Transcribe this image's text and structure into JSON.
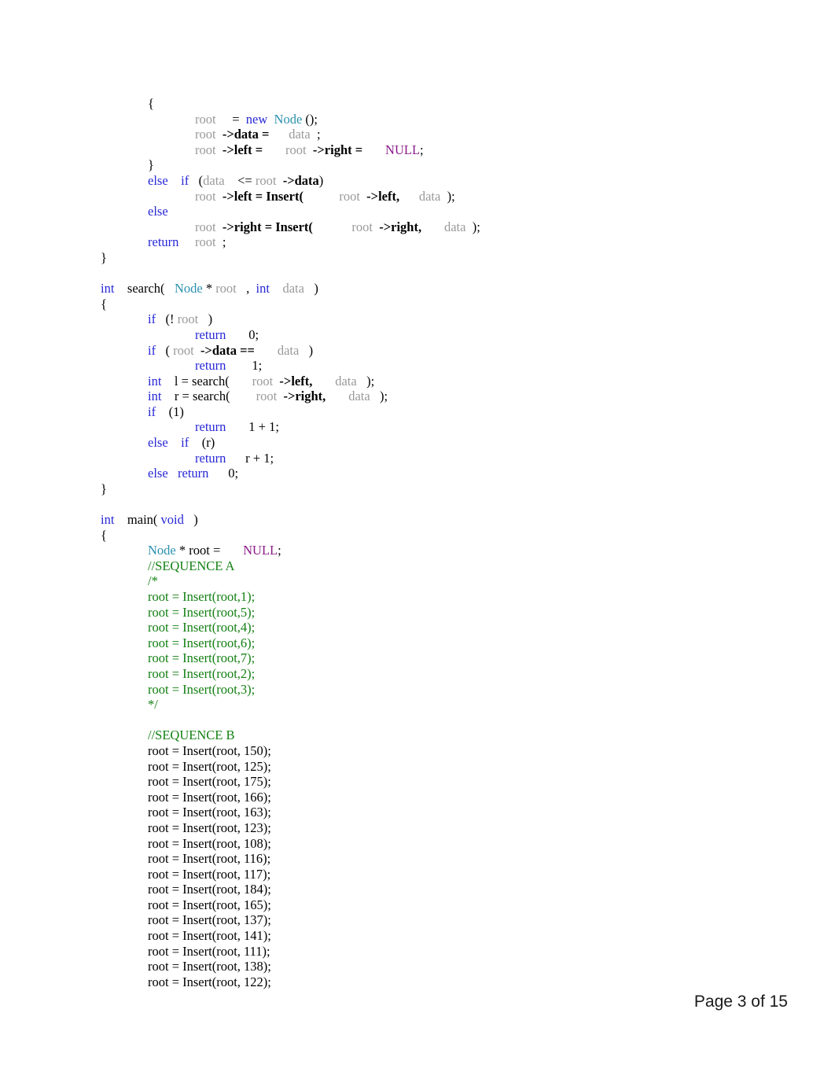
{
  "document": {
    "page_label": "Page 3 of 15",
    "colors": {
      "keyword": "#2727d6",
      "type": "#2b91af",
      "identifier": "#9a9a9a",
      "member": "#000000",
      "macro": "#8b1a8b",
      "comment": "#138013",
      "plain": "#000000",
      "background": "#ffffff"
    }
  },
  "code": {
    "lines": [
      {
        "indent": 1,
        "tokens": [
          {
            "t": "{",
            "c": "pl"
          }
        ]
      },
      {
        "indent": 2,
        "tokens": [
          {
            "t": "root",
            "c": "id"
          },
          {
            "t": "     =  ",
            "c": "pl"
          },
          {
            "t": "new",
            "c": "kw"
          },
          {
            "t": "  ",
            "c": "pl"
          },
          {
            "t": "Node",
            "c": "type"
          },
          {
            "t": " ();",
            "c": "pl"
          }
        ]
      },
      {
        "indent": 2,
        "tokens": [
          {
            "t": "root",
            "c": "id"
          },
          {
            "t": "  ",
            "c": "pl"
          },
          {
            "t": "->data =",
            "c": "mem"
          },
          {
            "t": "      ",
            "c": "pl"
          },
          {
            "t": "data",
            "c": "id"
          },
          {
            "t": "  ;",
            "c": "pl"
          }
        ]
      },
      {
        "indent": 2,
        "tokens": [
          {
            "t": "root",
            "c": "id"
          },
          {
            "t": "  ",
            "c": "pl"
          },
          {
            "t": "->left =",
            "c": "mem"
          },
          {
            "t": "       ",
            "c": "pl"
          },
          {
            "t": "root",
            "c": "id"
          },
          {
            "t": "  ",
            "c": "pl"
          },
          {
            "t": "->right =",
            "c": "mem"
          },
          {
            "t": "       ",
            "c": "pl"
          },
          {
            "t": "NULL",
            "c": "nul"
          },
          {
            "t": ";",
            "c": "pl"
          }
        ]
      },
      {
        "indent": 1,
        "tokens": [
          {
            "t": "}",
            "c": "pl"
          }
        ]
      },
      {
        "indent": 1,
        "tokens": [
          {
            "t": "else",
            "c": "kw"
          },
          {
            "t": "    ",
            "c": "pl"
          },
          {
            "t": "if",
            "c": "kw"
          },
          {
            "t": "   (",
            "c": "pl"
          },
          {
            "t": "data",
            "c": "id"
          },
          {
            "t": "    <= ",
            "c": "pl"
          },
          {
            "t": "root",
            "c": "id"
          },
          {
            "t": "  ",
            "c": "pl"
          },
          {
            "t": "->data",
            "c": "mem"
          },
          {
            "t": ")",
            "c": "pl"
          }
        ]
      },
      {
        "indent": 2,
        "tokens": [
          {
            "t": "root",
            "c": "id"
          },
          {
            "t": "  ",
            "c": "pl"
          },
          {
            "t": "->left = Insert(",
            "c": "mem"
          },
          {
            "t": "           ",
            "c": "pl"
          },
          {
            "t": "root",
            "c": "id"
          },
          {
            "t": "  ",
            "c": "pl"
          },
          {
            "t": "->left,",
            "c": "mem"
          },
          {
            "t": "      ",
            "c": "pl"
          },
          {
            "t": "data",
            "c": "id"
          },
          {
            "t": "  );",
            "c": "pl"
          }
        ]
      },
      {
        "indent": 1,
        "tokens": [
          {
            "t": "else",
            "c": "kw"
          }
        ]
      },
      {
        "indent": 2,
        "tokens": [
          {
            "t": "root",
            "c": "id"
          },
          {
            "t": "  ",
            "c": "pl"
          },
          {
            "t": "->right = Insert(",
            "c": "mem"
          },
          {
            "t": "            ",
            "c": "pl"
          },
          {
            "t": "root",
            "c": "id"
          },
          {
            "t": "  ",
            "c": "pl"
          },
          {
            "t": "->right,",
            "c": "mem"
          },
          {
            "t": "       ",
            "c": "pl"
          },
          {
            "t": "data",
            "c": "id"
          },
          {
            "t": "  );",
            "c": "pl"
          }
        ]
      },
      {
        "indent": 1,
        "tokens": [
          {
            "t": "return",
            "c": "kw"
          },
          {
            "t": "     ",
            "c": "pl"
          },
          {
            "t": "root",
            "c": "id"
          },
          {
            "t": "  ;",
            "c": "pl"
          }
        ]
      },
      {
        "indent": 0,
        "tokens": [
          {
            "t": "}",
            "c": "pl"
          }
        ]
      },
      {
        "indent": 0,
        "tokens": []
      },
      {
        "indent": 0,
        "tokens": [
          {
            "t": "int",
            "c": "kw"
          },
          {
            "t": "    search(",
            "c": "pl"
          },
          {
            "t": "   ",
            "c": "pl"
          },
          {
            "t": "Node",
            "c": "type"
          },
          {
            "t": " * ",
            "c": "pl"
          },
          {
            "t": "root",
            "c": "id"
          },
          {
            "t": "   ,  ",
            "c": "pl"
          },
          {
            "t": "int",
            "c": "kw"
          },
          {
            "t": "    ",
            "c": "pl"
          },
          {
            "t": "data",
            "c": "id"
          },
          {
            "t": "   )",
            "c": "pl"
          }
        ]
      },
      {
        "indent": 0,
        "tokens": [
          {
            "t": "{",
            "c": "pl"
          }
        ]
      },
      {
        "indent": 1,
        "tokens": [
          {
            "t": "if",
            "c": "kw"
          },
          {
            "t": "   (! ",
            "c": "pl"
          },
          {
            "t": "root",
            "c": "id"
          },
          {
            "t": "   )",
            "c": "pl"
          }
        ]
      },
      {
        "indent": 2,
        "tokens": [
          {
            "t": "return",
            "c": "kw"
          },
          {
            "t": "       0;",
            "c": "pl"
          }
        ]
      },
      {
        "indent": 1,
        "tokens": [
          {
            "t": "if",
            "c": "kw"
          },
          {
            "t": "   ( ",
            "c": "pl"
          },
          {
            "t": "root",
            "c": "id"
          },
          {
            "t": "  ",
            "c": "pl"
          },
          {
            "t": "->data ==",
            "c": "mem"
          },
          {
            "t": "       ",
            "c": "pl"
          },
          {
            "t": "data",
            "c": "id"
          },
          {
            "t": "   )",
            "c": "pl"
          }
        ]
      },
      {
        "indent": 2,
        "tokens": [
          {
            "t": "return",
            "c": "kw"
          },
          {
            "t": "        1;",
            "c": "pl"
          }
        ]
      },
      {
        "indent": 1,
        "tokens": [
          {
            "t": "int",
            "c": "kw"
          },
          {
            "t": "    l = search(",
            "c": "pl"
          },
          {
            "t": "       ",
            "c": "pl"
          },
          {
            "t": "root",
            "c": "id"
          },
          {
            "t": "  ",
            "c": "pl"
          },
          {
            "t": "->left,",
            "c": "mem"
          },
          {
            "t": "       ",
            "c": "pl"
          },
          {
            "t": "data",
            "c": "id"
          },
          {
            "t": "   );",
            "c": "pl"
          }
        ]
      },
      {
        "indent": 1,
        "tokens": [
          {
            "t": "int",
            "c": "kw"
          },
          {
            "t": "    r = search(",
            "c": "pl"
          },
          {
            "t": "        ",
            "c": "pl"
          },
          {
            "t": "root",
            "c": "id"
          },
          {
            "t": "  ",
            "c": "pl"
          },
          {
            "t": "->right,",
            "c": "mem"
          },
          {
            "t": "       ",
            "c": "pl"
          },
          {
            "t": "data",
            "c": "id"
          },
          {
            "t": "   );",
            "c": "pl"
          }
        ]
      },
      {
        "indent": 1,
        "tokens": [
          {
            "t": "if",
            "c": "kw"
          },
          {
            "t": "    (1)",
            "c": "pl"
          }
        ]
      },
      {
        "indent": 2,
        "tokens": [
          {
            "t": "return",
            "c": "kw"
          },
          {
            "t": "       1 + 1;",
            "c": "pl"
          }
        ]
      },
      {
        "indent": 1,
        "tokens": [
          {
            "t": "else",
            "c": "kw"
          },
          {
            "t": "    ",
            "c": "pl"
          },
          {
            "t": "if",
            "c": "kw"
          },
          {
            "t": "    (r)",
            "c": "pl"
          }
        ]
      },
      {
        "indent": 2,
        "tokens": [
          {
            "t": "return",
            "c": "kw"
          },
          {
            "t": "      r + 1;",
            "c": "pl"
          }
        ]
      },
      {
        "indent": 1,
        "tokens": [
          {
            "t": "else",
            "c": "kw"
          },
          {
            "t": "   ",
            "c": "pl"
          },
          {
            "t": "return",
            "c": "kw"
          },
          {
            "t": "      0;",
            "c": "pl"
          }
        ]
      },
      {
        "indent": 0,
        "tokens": [
          {
            "t": "}",
            "c": "pl"
          }
        ]
      },
      {
        "indent": 0,
        "tokens": []
      },
      {
        "indent": 0,
        "tokens": [
          {
            "t": "int",
            "c": "kw"
          },
          {
            "t": "    main( ",
            "c": "pl"
          },
          {
            "t": "void",
            "c": "kw"
          },
          {
            "t": "   )",
            "c": "pl"
          }
        ]
      },
      {
        "indent": 0,
        "tokens": [
          {
            "t": "{",
            "c": "pl"
          }
        ]
      },
      {
        "indent": 1,
        "tokens": [
          {
            "t": "Node",
            "c": "type"
          },
          {
            "t": " * root =",
            "c": "pl"
          },
          {
            "t": "       ",
            "c": "pl"
          },
          {
            "t": "NULL",
            "c": "nul"
          },
          {
            "t": ";",
            "c": "pl"
          }
        ]
      },
      {
        "indent": 1,
        "tokens": [
          {
            "t": "//SEQUENCE A",
            "c": "cmt"
          }
        ]
      },
      {
        "indent": 1,
        "tokens": [
          {
            "t": "/*",
            "c": "cmt"
          }
        ]
      },
      {
        "indent": 1,
        "tokens": [
          {
            "t": "root = Insert(root,1);",
            "c": "cmt"
          }
        ]
      },
      {
        "indent": 1,
        "tokens": [
          {
            "t": "root = Insert(root,5);",
            "c": "cmt"
          }
        ]
      },
      {
        "indent": 1,
        "tokens": [
          {
            "t": "root = Insert(root,4);",
            "c": "cmt"
          }
        ]
      },
      {
        "indent": 1,
        "tokens": [
          {
            "t": "root = Insert(root,6);",
            "c": "cmt"
          }
        ]
      },
      {
        "indent": 1,
        "tokens": [
          {
            "t": "root = Insert(root,7);",
            "c": "cmt"
          }
        ]
      },
      {
        "indent": 1,
        "tokens": [
          {
            "t": "root = Insert(root,2);",
            "c": "cmt"
          }
        ]
      },
      {
        "indent": 1,
        "tokens": [
          {
            "t": "root = Insert(root,3);",
            "c": "cmt"
          }
        ]
      },
      {
        "indent": 1,
        "tokens": [
          {
            "t": "*/",
            "c": "cmt"
          }
        ]
      },
      {
        "indent": 0,
        "tokens": []
      },
      {
        "indent": 1,
        "tokens": [
          {
            "t": "//SEQUENCE B",
            "c": "cmt"
          }
        ]
      },
      {
        "indent": 1,
        "tokens": [
          {
            "t": "root = Insert(root, 150);",
            "c": "pl"
          }
        ]
      },
      {
        "indent": 1,
        "tokens": [
          {
            "t": "root = Insert(root, 125);",
            "c": "pl"
          }
        ]
      },
      {
        "indent": 1,
        "tokens": [
          {
            "t": "root = Insert(root, 175);",
            "c": "pl"
          }
        ]
      },
      {
        "indent": 1,
        "tokens": [
          {
            "t": "root = Insert(root, 166);",
            "c": "pl"
          }
        ]
      },
      {
        "indent": 1,
        "tokens": [
          {
            "t": "root = Insert(root, 163);",
            "c": "pl"
          }
        ]
      },
      {
        "indent": 1,
        "tokens": [
          {
            "t": "root = Insert(root, 123);",
            "c": "pl"
          }
        ]
      },
      {
        "indent": 1,
        "tokens": [
          {
            "t": "root = Insert(root, 108);",
            "c": "pl"
          }
        ]
      },
      {
        "indent": 1,
        "tokens": [
          {
            "t": "root = Insert(root, 116);",
            "c": "pl"
          }
        ]
      },
      {
        "indent": 1,
        "tokens": [
          {
            "t": "root = Insert(root, 117);",
            "c": "pl"
          }
        ]
      },
      {
        "indent": 1,
        "tokens": [
          {
            "t": "root = Insert(root, 184);",
            "c": "pl"
          }
        ]
      },
      {
        "indent": 1,
        "tokens": [
          {
            "t": "root = Insert(root, 165);",
            "c": "pl"
          }
        ]
      },
      {
        "indent": 1,
        "tokens": [
          {
            "t": "root = Insert(root, 137);",
            "c": "pl"
          }
        ]
      },
      {
        "indent": 1,
        "tokens": [
          {
            "t": "root = Insert(root, 141);",
            "c": "pl"
          }
        ]
      },
      {
        "indent": 1,
        "tokens": [
          {
            "t": "root = Insert(root, 111);",
            "c": "pl"
          }
        ]
      },
      {
        "indent": 1,
        "tokens": [
          {
            "t": "root = Insert(root, 138);",
            "c": "pl"
          }
        ]
      },
      {
        "indent": 1,
        "tokens": [
          {
            "t": "root = Insert(root, 122);",
            "c": "pl"
          }
        ]
      }
    ],
    "sequence_a_values": [
      1,
      5,
      4,
      6,
      7,
      2,
      3
    ],
    "sequence_b_values": [
      150,
      125,
      175,
      166,
      163,
      123,
      108,
      116,
      117,
      184,
      165,
      137,
      141,
      111,
      138,
      122
    ]
  }
}
